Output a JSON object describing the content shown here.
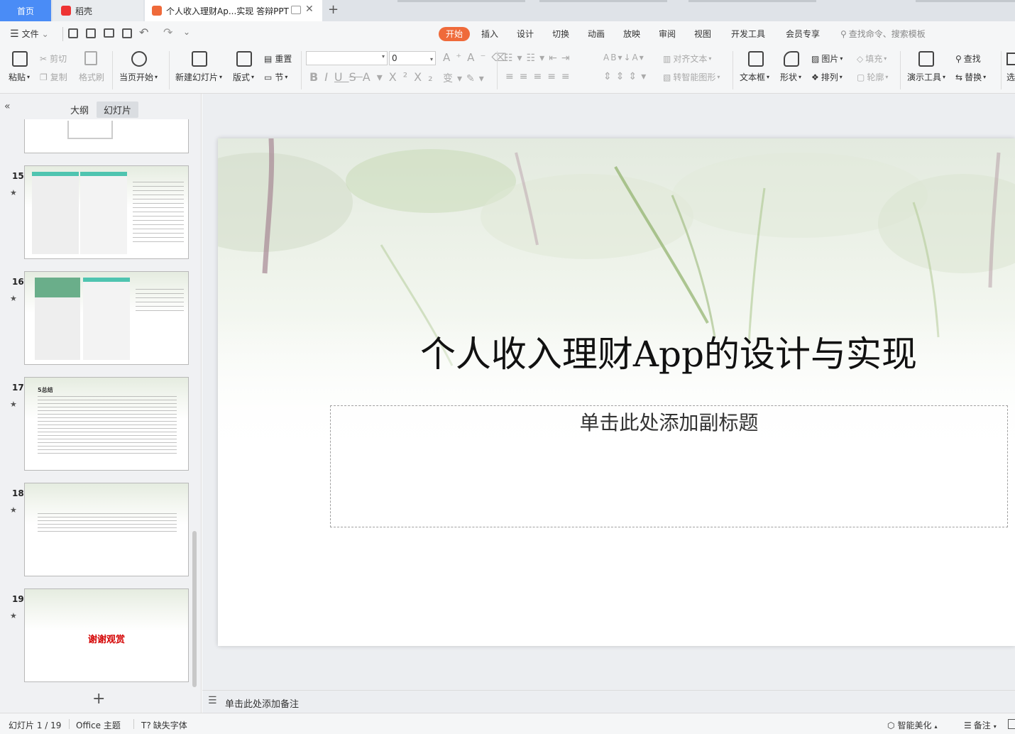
{
  "tabs": {
    "home": "首页",
    "daoke": "稻壳",
    "doc": "个人收入理财Ap...实现 答辩PPT",
    "add_tab": "+"
  },
  "menu": {
    "file": "文件",
    "ribbon_tabs": [
      "开始",
      "插入",
      "设计",
      "切换",
      "动画",
      "放映",
      "审阅",
      "视图",
      "开发工具",
      "会员专享"
    ],
    "search": "查找命令、搜索模板"
  },
  "ribbon": {
    "paste": "粘贴",
    "cut": "剪切",
    "copy": "复制",
    "format_painter": "格式刷",
    "play_from_current": "当页开始",
    "new_slide": "新建幻灯片",
    "layout": "版式",
    "reset": "重置",
    "section": "节",
    "font_size_value": "0",
    "align_text": "对齐文本",
    "smart_shape": "转智能图形",
    "textbox": "文本框",
    "shape": "形状",
    "picture": "图片",
    "arrange": "排列",
    "fill": "填充",
    "outline": "轮廓",
    "present_tool": "演示工具",
    "find": "查找",
    "replace": "替换",
    "select": "选"
  },
  "left_pane": {
    "outline_tab": "大纲",
    "slides_tab": "幻灯片",
    "add_slide": "+"
  },
  "thumbnails": [
    {
      "number": "15"
    },
    {
      "number": "16"
    },
    {
      "number": "17",
      "heading": "5总结"
    },
    {
      "number": "18"
    },
    {
      "number": "19",
      "text": "谢谢观赏"
    }
  ],
  "slide": {
    "title": "个人收入理财App的设计与实现",
    "subtitle_placeholder": "单击此处添加副标题"
  },
  "notes_placeholder": "单击此处添加备注",
  "status": {
    "slide_counter": "幻灯片 1 / 19",
    "theme": "Office 主题",
    "missing_font": "缺失字体",
    "smart_beautify": "智能美化",
    "notes": "备注"
  },
  "colors": {
    "accent": "#ef6a3a",
    "home_tab": "#4a8cf6",
    "thumb_title_red": "#d40000"
  }
}
